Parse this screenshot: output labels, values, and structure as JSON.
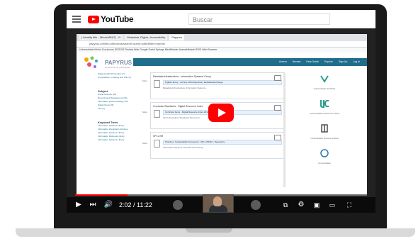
{
  "youtube": {
    "logo_text": "YouTube",
    "search_placeholder": "Buscar"
  },
  "browser": {
    "tabs": [
      "| Identify title - MindsMBI(T) - N",
      "Metadata, Rights, Accessibility",
      "Papyrus"
    ],
    "address": "papyrus.uminho.pt/browse/search?query=pdf&filters=eprints",
    "bookmarks": "Universidade Minho  Curriculum DEGOIS  Revista Web  Google  Social Springs  MindMeister  Acessibilidade  RDSI Web Browser"
  },
  "site": {
    "logo_text": "PAPYRUS",
    "logo_sub": "Repositório de publicações",
    "nav": [
      "Acerca",
      "Browse",
      "Help Guide",
      "Explore",
      "Sign Up",
      "Log In"
    ],
    "sidebar": [
      {
        "heading": "",
        "lines": [
          "Digital Health Informatics (2)",
          "Computation, meaning and Phil. (1)"
        ],
        "more": "More"
      },
      {
        "heading": "Subject",
        "lines": [
          "Social Network (29)",
          "Records and Management (16)",
          "Information and Knowledge (15)",
          "Digital Sound (6)",
          "Law (1)"
        ],
        "more": "More"
      },
      {
        "heading": "Keyword Trees",
        "lines": [
          "Information Systems Library",
          "Information Integration Archives",
          "Information Systems Library",
          "Information Retrieval Library",
          "Information Systems Library"
        ],
        "more": "More"
      }
    ],
    "cards": [
      {
        "title": "Metadata Infrastructure - Information Systems Group",
        "ref": "Digital Library... Archive 2019 Repository Metadata Exchange",
        "desc": "Metadata Infrastructure; Information Systems..."
      },
      {
        "title": "Curricular Standards - Digital Resource Index",
        "ref": "Curricular Items - Digital Resource Index 2019 Tools",
        "desc": "Open Repository Standards Document..."
      },
      {
        "title": "SPLL  BR",
        "ref": "Practices, Sustainability Framework - SPLL INFRA - Repository",
        "desc": "Information Systems Thematic Processing..."
      }
    ],
    "universities": [
      {
        "name": "Universidade do Minho"
      },
      {
        "name": "Universidade Federal do Ceará"
      },
      {
        "name": "Universidade Nova de Lisboa"
      },
      {
        "name": "Universidade"
      }
    ]
  },
  "player": {
    "time": "2:02 / 11:22",
    "progress": 0.18
  },
  "colors": {
    "youtube_red": "#ff0000",
    "site_nav": "#1f6d8a",
    "laptop_frame": "#1a1a1a"
  }
}
